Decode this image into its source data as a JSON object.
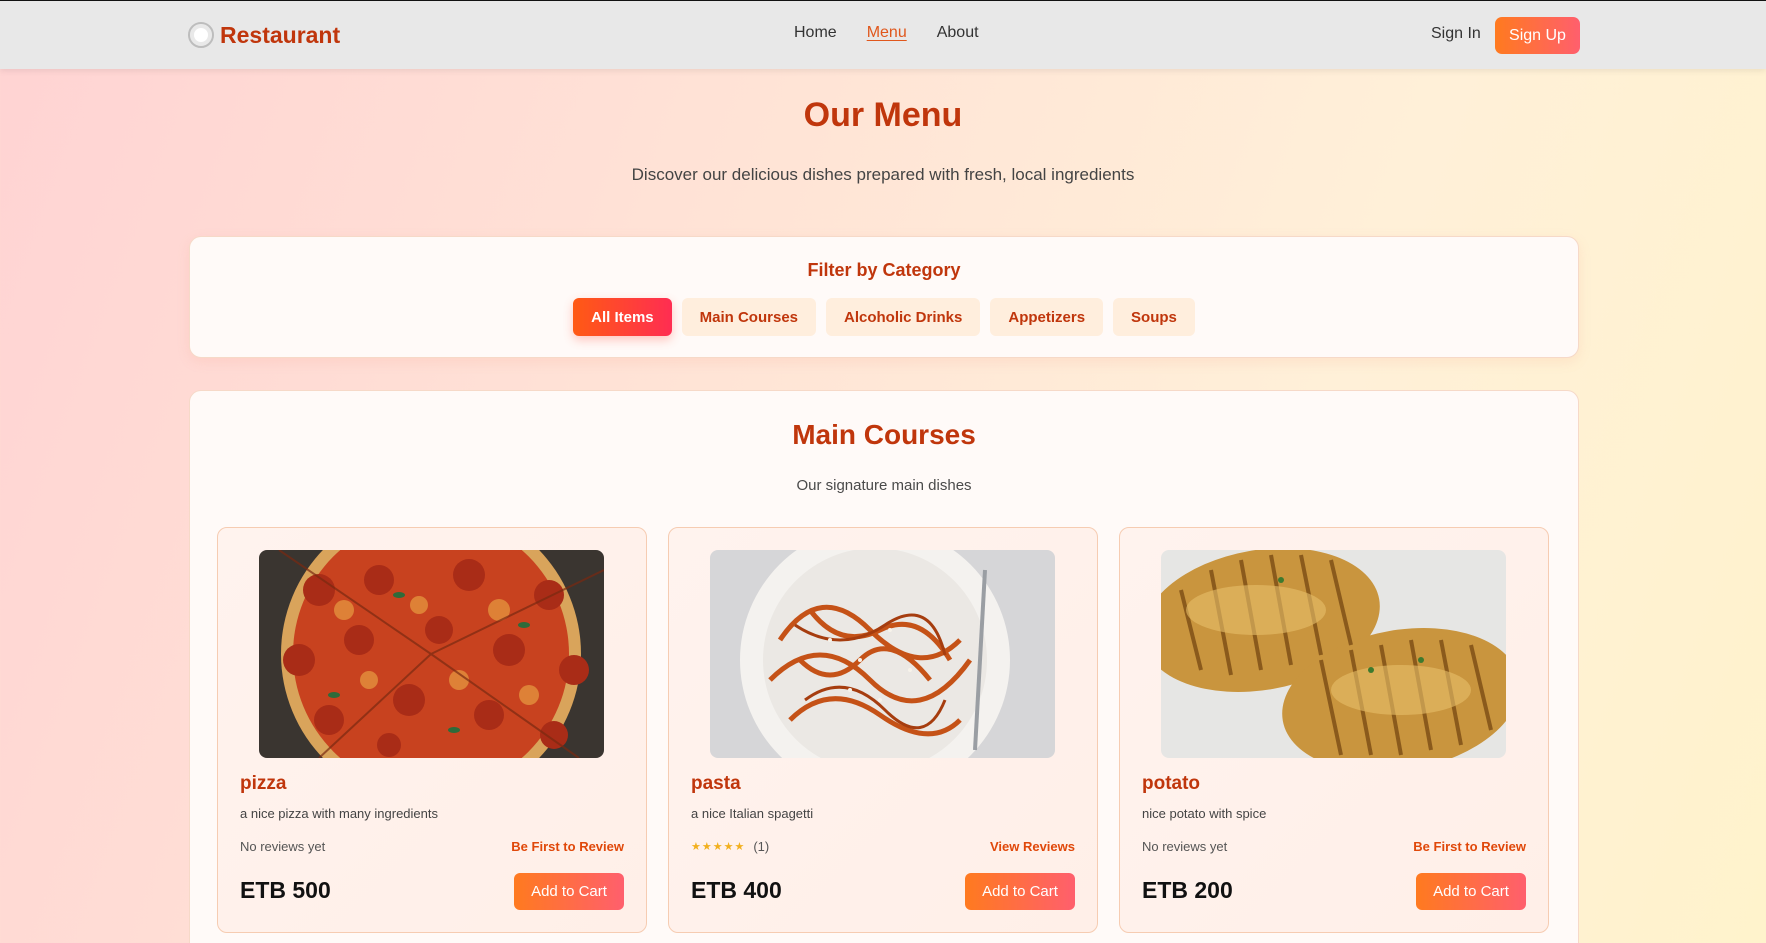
{
  "nav": {
    "brand": "Restaurant",
    "brand_icon": "plate-icon",
    "links": [
      "Home",
      "Menu",
      "About"
    ],
    "active": "Menu",
    "sign_in": "Sign In",
    "sign_up": "Sign Up"
  },
  "hero": {
    "title": "Our Menu",
    "subtitle": "Discover our delicious dishes prepared with fresh, local ingredients"
  },
  "filter": {
    "title": "Filter by Category",
    "categories": [
      "All Items",
      "Main Courses",
      "Alcoholic Drinks",
      "Appetizers",
      "Soups"
    ],
    "selected": "All Items"
  },
  "section": {
    "title": "Main Courses",
    "subtitle": "Our signature main dishes",
    "items": [
      {
        "name": "pizza",
        "description": "a nice pizza with many ingredients",
        "rating_text": "No reviews yet",
        "stars": "",
        "review_count": "",
        "review_link": "Be First to Review",
        "price": "ETB 500",
        "button": "Add to Cart",
        "image": "pizza-photo"
      },
      {
        "name": "pasta",
        "description": "a nice Italian spagetti",
        "rating_text": "",
        "stars": "★★★★★",
        "review_count": "(1)",
        "review_link": "View Reviews",
        "price": "ETB 400",
        "button": "Add to Cart",
        "image": "pasta-photo"
      },
      {
        "name": "potato",
        "description": "nice potato with spice",
        "rating_text": "No reviews yet",
        "stars": "",
        "review_count": "",
        "review_link": "Be First to Review",
        "price": "ETB 200",
        "button": "Add to Cart",
        "image": "potato-photo"
      }
    ]
  },
  "colors": {
    "accent": "#c0360c",
    "button_gradient_start": "#ff7a1f",
    "button_gradient_end": "#ff5f6d",
    "star": "#f2b01e"
  }
}
